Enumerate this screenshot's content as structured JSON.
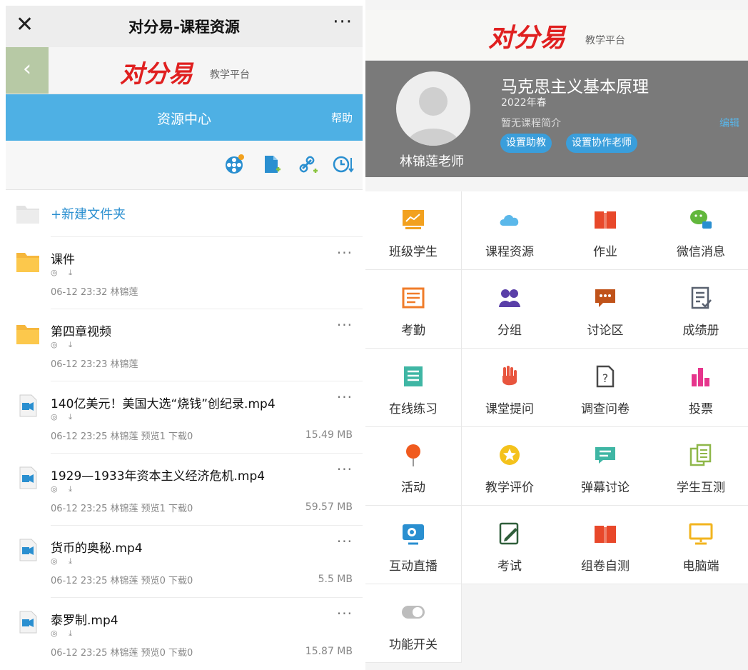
{
  "left": {
    "window": {
      "close_icon": "close-icon",
      "title": "对分易-课程资源",
      "more": "···"
    },
    "brand": {
      "back": "‹",
      "logo": "对分易",
      "subtitle": "教学平台"
    },
    "header": {
      "title": "资源中心",
      "help": "帮助"
    },
    "toolbar": {
      "icons": [
        "video-reel-icon",
        "add-file-icon",
        "add-link-icon",
        "history-sort-icon"
      ]
    },
    "new_folder": "+新建文件夹",
    "items": [
      {
        "type": "folder",
        "name": "课件",
        "icons": "◎ ⤓",
        "meta": "06-12 23:32 林锦莲",
        "size": "",
        "more": "···"
      },
      {
        "type": "folder",
        "name": "第四章视频",
        "icons": "◎ ⤓",
        "meta": "06-12 23:23 林锦莲",
        "size": "",
        "more": "···"
      },
      {
        "type": "video",
        "name": "140亿美元！美国大选“烧钱”创纪录.mp4",
        "icons": "◎ ⤓",
        "meta": "06-12 23:25 林锦莲 预览1 下载0",
        "size": "15.49 MB",
        "more": "···"
      },
      {
        "type": "video",
        "name": "1929—1933年资本主义经济危机.mp4",
        "icons": "◎ ⤓",
        "meta": "06-12 23:25 林锦莲 预览1 下载0",
        "size": "59.57 MB",
        "more": "···"
      },
      {
        "type": "video",
        "name": "货币的奥秘.mp4",
        "icons": "◎ ⤓",
        "meta": "06-12 23:25 林锦莲 预览0 下载0",
        "size": "5.5 MB",
        "more": "···"
      },
      {
        "type": "video",
        "name": "泰罗制.mp4",
        "icons": "◎ ⤓",
        "meta": "06-12 23:25 林锦莲 预览0 下载0",
        "size": "15.87 MB",
        "more": "···"
      }
    ]
  },
  "right": {
    "brand": {
      "logo": "对分易",
      "subtitle": "教学平台"
    },
    "course": {
      "teacher": "林锦莲老师",
      "title": "马克思主义基本原理",
      "term": "2022年春",
      "intro": "暂无课程简介",
      "edit": "编辑",
      "buttons": [
        "设置助教",
        "设置协作老师"
      ]
    },
    "features": [
      {
        "label": "班级学生",
        "icon": "class-students-icon",
        "color": "#f2a11f"
      },
      {
        "label": "课程资源",
        "icon": "cloud-icon",
        "color": "#5bb8ea"
      },
      {
        "label": "作业",
        "icon": "book-icon",
        "color": "#e8482a"
      },
      {
        "label": "微信消息",
        "icon": "wechat-message-icon",
        "color": "#62b73c"
      },
      {
        "label": "考勤",
        "icon": "attendance-icon",
        "color": "#f07c2a"
      },
      {
        "label": "分组",
        "icon": "group-icon",
        "color": "#5a3fa8"
      },
      {
        "label": "讨论区",
        "icon": "chat-bubble-icon",
        "color": "#c0531a"
      },
      {
        "label": "成绩册",
        "icon": "gradebook-icon",
        "color": "#5a6270"
      },
      {
        "label": "在线练习",
        "icon": "practice-list-icon",
        "color": "#3fb6a4"
      },
      {
        "label": "课堂提问",
        "icon": "raise-hand-icon",
        "color": "#e8553e"
      },
      {
        "label": "调查问卷",
        "icon": "questionnaire-icon",
        "color": "#4a4a4a"
      },
      {
        "label": "投票",
        "icon": "vote-chart-icon",
        "color": "#e6358c"
      },
      {
        "label": "活动",
        "icon": "pin-icon",
        "color": "#f05a1e"
      },
      {
        "label": "教学评价",
        "icon": "star-badge-icon",
        "color": "#f4c21c"
      },
      {
        "label": "弹幕讨论",
        "icon": "danmaku-icon",
        "color": "#3fb6a4"
      },
      {
        "label": "学生互测",
        "icon": "peer-test-icon",
        "color": "#8fb74a"
      },
      {
        "label": "互动直播",
        "icon": "live-stream-icon",
        "color": "#2a8fd0"
      },
      {
        "label": "考试",
        "icon": "exam-icon",
        "color": "#2f5e3a"
      },
      {
        "label": "组卷自测",
        "icon": "self-test-book-icon",
        "color": "#e8482a"
      },
      {
        "label": "电脑端",
        "icon": "desktop-icon",
        "color": "#f2b41f"
      },
      {
        "label": "功能开关",
        "icon": "toggle-icon",
        "color": "#bdbdbd"
      }
    ]
  }
}
